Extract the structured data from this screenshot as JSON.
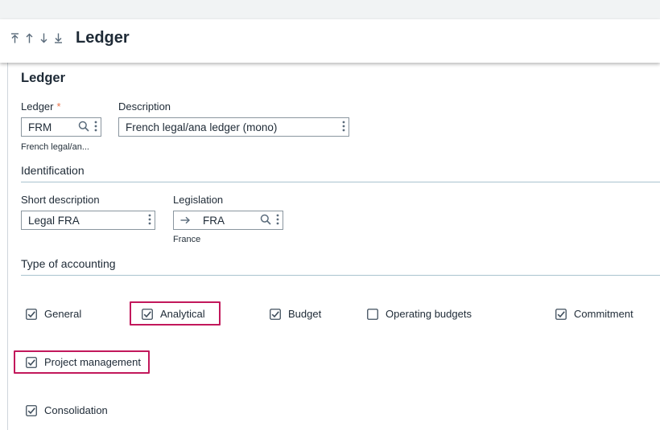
{
  "header": {
    "title": "Ledger",
    "nav_icons": [
      "first-record-icon",
      "previous-record-icon",
      "next-record-icon",
      "last-record-icon"
    ]
  },
  "section": {
    "title": "Ledger"
  },
  "ledger_field": {
    "label": "Ledger",
    "required_mark": "*",
    "value": "FRM",
    "hint": "French legal/an..."
  },
  "description_field": {
    "label": "Description",
    "value": "French legal/ana ledger (mono)"
  },
  "identification": {
    "title": "Identification",
    "short_description": {
      "label": "Short description",
      "value": "Legal FRA"
    },
    "legislation": {
      "label": "Legislation",
      "value": "FRA",
      "hint": "France"
    }
  },
  "accounting": {
    "title": "Type of accounting",
    "options": [
      {
        "label": "General",
        "checked": true
      },
      {
        "label": "Analytical",
        "checked": true,
        "highlighted": true
      },
      {
        "label": "Budget",
        "checked": true
      },
      {
        "label": "Operating budgets",
        "checked": false
      },
      {
        "label": "Commitment",
        "checked": true
      },
      {
        "label": "Project management",
        "checked": true,
        "highlighted": true
      },
      {
        "label": "Consolidation",
        "checked": true
      }
    ]
  },
  "colors": {
    "accent_line": "#a9c3cf",
    "required": "#e8734a",
    "highlight": "#c2185b",
    "icon": "#5a6b7b"
  }
}
